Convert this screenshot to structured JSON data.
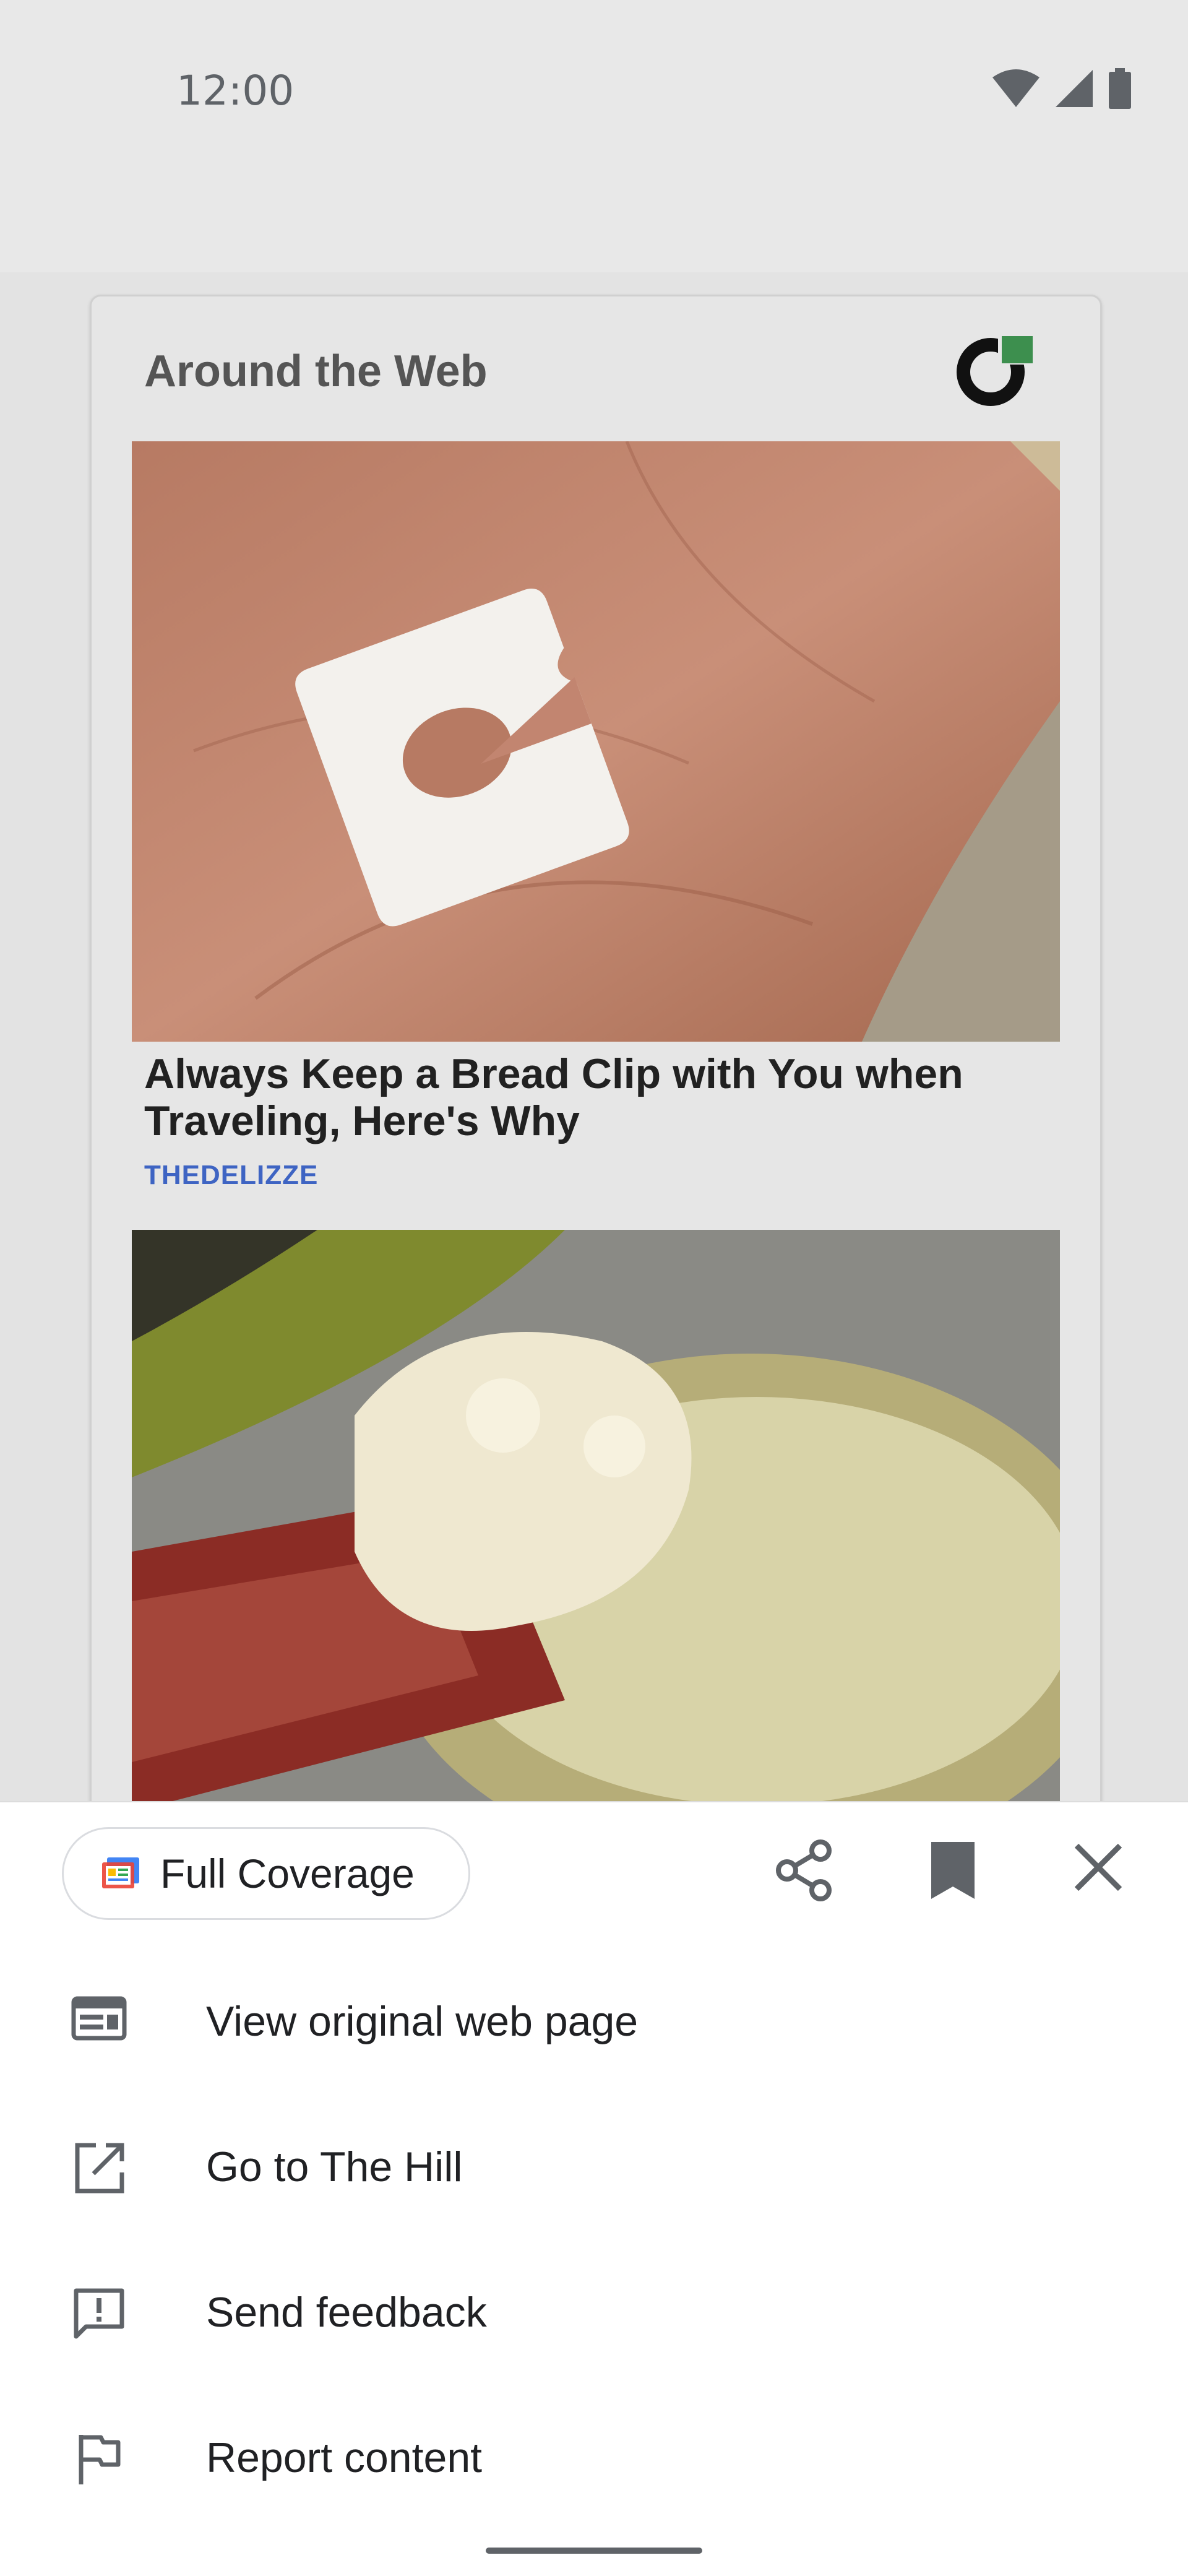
{
  "status_bar": {
    "time": "12:00"
  },
  "card": {
    "title": "Around the Web",
    "articles": [
      {
        "title": "Always Keep a Bread Clip with You when Traveling, Here's Why",
        "source": "THEDELIZZE"
      }
    ]
  },
  "sheet": {
    "chip_label": "Full Coverage",
    "menu": [
      {
        "label": "View original web page",
        "icon": "web-page-icon"
      },
      {
        "label": "Go to The Hill",
        "icon": "open-external-icon"
      },
      {
        "label": "Send feedback",
        "icon": "feedback-icon"
      },
      {
        "label": "Report content",
        "icon": "flag-icon"
      }
    ]
  },
  "colors": {
    "accent": "#3e64c3",
    "text": "#202124",
    "icon": "#5f6368"
  }
}
